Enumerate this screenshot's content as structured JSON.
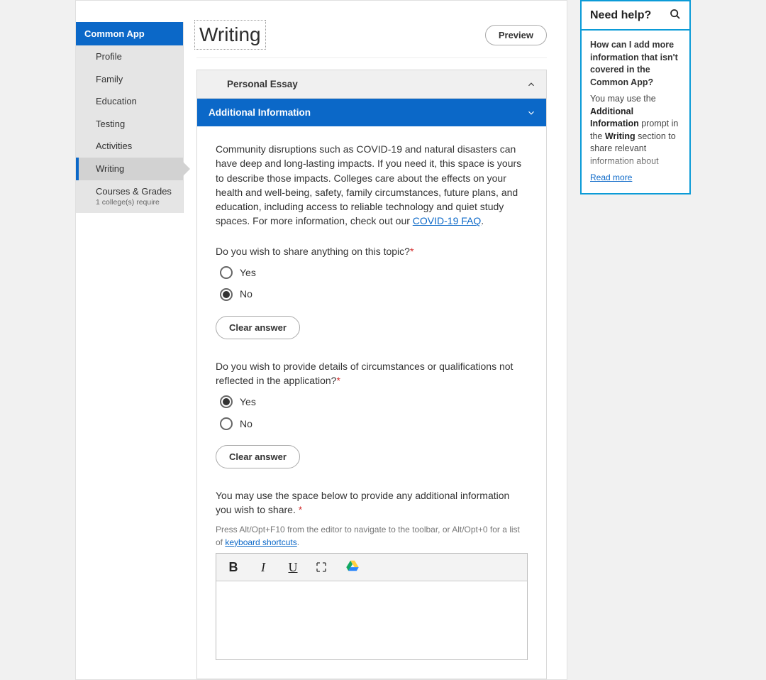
{
  "sidebar": {
    "header": "Common App",
    "items": [
      {
        "label": "Profile"
      },
      {
        "label": "Family"
      },
      {
        "label": "Education"
      },
      {
        "label": "Testing"
      },
      {
        "label": "Activities"
      },
      {
        "label": "Writing",
        "active": true
      },
      {
        "label": "Courses & Grades",
        "sub": "1 college(s) require"
      }
    ]
  },
  "main": {
    "title": "Writing",
    "preview_label": "Preview",
    "sections": {
      "personal_essay": {
        "title": "Personal Essay"
      },
      "additional_info": {
        "title": "Additional Information"
      }
    },
    "intro_text": "Community disruptions such as COVID-19 and natural disasters can have deep and long-lasting impacts. If you need it, this space is yours to describe those impacts. Colleges care about the effects on your health and well-being, safety, family circumstances, future plans, and education, including access to reliable technology and quiet study spaces. For more information, check out our ",
    "intro_link": "COVID-19 FAQ",
    "q1": {
      "label": "Do you wish to share anything on this topic?",
      "yes": "Yes",
      "no": "No",
      "selected": "No",
      "clear": "Clear answer"
    },
    "q2": {
      "label": "Do you wish to provide details of circumstances or qualifications not reflected in the application?",
      "yes": "Yes",
      "no": "No",
      "selected": "Yes",
      "clear": "Clear answer"
    },
    "essay_prompt": "You may use the space below to provide any additional information you wish to share. ",
    "editor_hint_pre": "Press Alt/Opt+F10 from the editor to navigate to the toolbar, or Alt/Opt+0 for a list of ",
    "editor_hint_link": "keyboard shortcuts",
    "toolbar": {
      "bold": "B",
      "italic": "I",
      "underline": "U"
    }
  },
  "help": {
    "title": "Need help?",
    "question": "How can I add more information that isn't covered in the Common App?",
    "answer_pre": "You may use the ",
    "answer_bold1": "Additional Information",
    "answer_mid": " prompt in the ",
    "answer_bold2": "Writing",
    "answer_post": " section to share relevant information about",
    "read_more": "Read more"
  }
}
